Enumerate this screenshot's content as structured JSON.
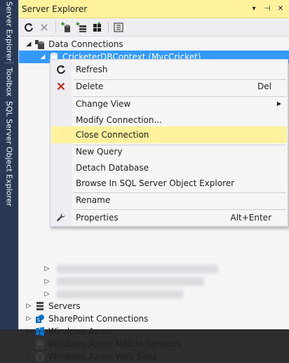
{
  "side_tabs": [
    {
      "label": "Server Explorer"
    },
    {
      "label": "Toolbox"
    },
    {
      "label": "SQL Server Object Explorer"
    }
  ],
  "panel": {
    "title": "Server Explorer",
    "title_buttons": {
      "dropdown": "▾",
      "pin": "⊣",
      "close": "✕"
    }
  },
  "toolbar": {
    "icons": [
      "refresh-icon",
      "stop-icon",
      "connect-to-database-icon",
      "connect-to-server-icon",
      "connect-to-azure-icon",
      "properties-icon"
    ]
  },
  "tree": {
    "data_connections": "Data Connections",
    "selected_connection": "CricketerDBContext (MvcCricket)",
    "servers": "Servers",
    "sharepoint": "SharePoint Connections",
    "azure": "Windows Azure",
    "azure_mobile": "Windows Azure Mobile Services",
    "azure_web": "Windows Azure Web Sites"
  },
  "context_menu": {
    "refresh": "Refresh",
    "delete": "Delete",
    "delete_shortcut": "Del",
    "change_view": "Change View",
    "modify_connection": "Modify Connection...",
    "close_connection": "Close Connection",
    "new_query": "New Query",
    "detach_database": "Detach Database",
    "browse_sql": "Browse In SQL Server Object Explorer",
    "rename": "Rename",
    "properties": "Properties",
    "properties_shortcut": "Alt+Enter"
  },
  "colors": {
    "title_highlight": "#fff29d",
    "selection": "#3399ff",
    "side_strip": "#293955",
    "delete_red": "#c42b1c"
  }
}
